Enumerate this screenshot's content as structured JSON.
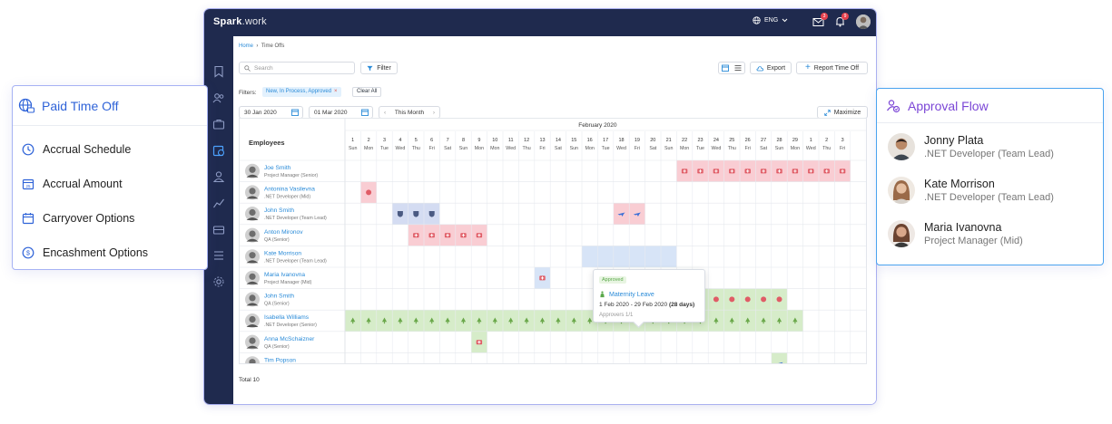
{
  "app": {
    "logo_main": "Spark",
    "logo_tail": ".work",
    "lang": "ENG",
    "mail_badge": "3",
    "bell_badge": "9"
  },
  "breadcrumb": {
    "home": "Home",
    "current": "Time Offs"
  },
  "toolbar": {
    "search_placeholder": "Search",
    "filter": "Filter",
    "export": "Export",
    "report": "Report Time Off",
    "maximize": "Maximize"
  },
  "filters": {
    "label": "Filters:",
    "chip": "New, In Process, Approved",
    "clear": "Clear All"
  },
  "dates": {
    "from": "30 Jan 2020",
    "to": "01 Mar 2020",
    "period": "This Month"
  },
  "calendar": {
    "month": "February 2020",
    "employees_header": "Employees",
    "days": [
      {
        "n": "1",
        "d": "Sun"
      },
      {
        "n": "2",
        "d": "Mon"
      },
      {
        "n": "3",
        "d": "Tue"
      },
      {
        "n": "4",
        "d": "Wed"
      },
      {
        "n": "5",
        "d": "Thu"
      },
      {
        "n": "6",
        "d": "Fri"
      },
      {
        "n": "7",
        "d": "Sat"
      },
      {
        "n": "8",
        "d": "Sun"
      },
      {
        "n": "9",
        "d": "Mon"
      },
      {
        "n": "10",
        "d": "Mon"
      },
      {
        "n": "11",
        "d": "Wed"
      },
      {
        "n": "12",
        "d": "Thu"
      },
      {
        "n": "13",
        "d": "Fri"
      },
      {
        "n": "14",
        "d": "Sat"
      },
      {
        "n": "15",
        "d": "Sun"
      },
      {
        "n": "16",
        "d": "Mon"
      },
      {
        "n": "17",
        "d": "Tue"
      },
      {
        "n": "18",
        "d": "Wed"
      },
      {
        "n": "19",
        "d": "Fri"
      },
      {
        "n": "20",
        "d": "Sat"
      },
      {
        "n": "21",
        "d": "Sun"
      },
      {
        "n": "22",
        "d": "Mon"
      },
      {
        "n": "23",
        "d": "Tue"
      },
      {
        "n": "24",
        "d": "Wed"
      },
      {
        "n": "25",
        "d": "Thu"
      },
      {
        "n": "26",
        "d": "Fri"
      },
      {
        "n": "27",
        "d": "Sat"
      },
      {
        "n": "28",
        "d": "Sun"
      },
      {
        "n": "29",
        "d": "Mon"
      },
      {
        "n": "1",
        "d": "Wed"
      },
      {
        "n": "2",
        "d": "Thu"
      },
      {
        "n": "3",
        "d": "Fri"
      }
    ],
    "employees": [
      {
        "name": "Joe Smith",
        "role": "Project Manager (Senior)"
      },
      {
        "name": "Antonina Vasilevna",
        "role": ".NET Developer (Mid)"
      },
      {
        "name": "John Smith",
        "role": ".NET Developer (Team Lead)"
      },
      {
        "name": "Anton Mironov",
        "role": "QA (Senior)"
      },
      {
        "name": "Kate Morrison",
        "role": ".NET Developer (Team Lead)"
      },
      {
        "name": "Maria Ivanovna",
        "role": "Project Manager (Mid)"
      },
      {
        "name": "John Smith",
        "role": "QA (Senior)"
      },
      {
        "name": "Isabella Williams",
        "role": ".NET Developer (Senior)"
      },
      {
        "name": "Anna McSchaizner",
        "role": "QA (Senior)"
      },
      {
        "name": "Tim Popson",
        "role": ".NET Developer (Senior)"
      }
    ],
    "leave_colors": {
      "sick": "#f9cdd3",
      "vacation_shield": "#d4dcf2",
      "travel": "#f9cdd3",
      "maternity": "#d6ecc9",
      "selected": "#d7e4f7"
    },
    "total": "Total 10"
  },
  "tooltip": {
    "status": "Approved",
    "type": "Maternity Leave",
    "dates": "1 Feb 2020 - 29 Feb 2020",
    "days": "(28 days)",
    "approvers": "Approvers 1/1"
  },
  "pto": {
    "title": "Paid Time Off",
    "items": [
      "Accrual Schedule",
      "Accrual Amount",
      "Carryover Options",
      "Encashment Options"
    ]
  },
  "approval": {
    "title": "Approval Flow",
    "people": [
      {
        "name": "Jonny Plata",
        "role": ".NET Developer (Team Lead)"
      },
      {
        "name": "Kate Morrison",
        "role": ".NET Developer (Team Lead)"
      },
      {
        "name": "Maria Ivanovna",
        "role": "Project Manager (Mid)"
      }
    ]
  }
}
